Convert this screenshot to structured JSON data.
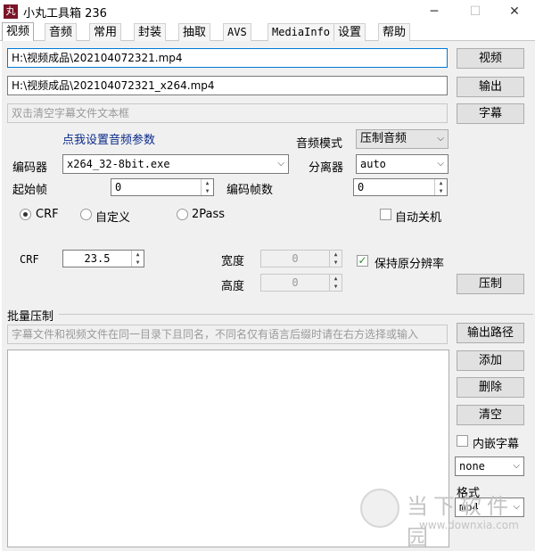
{
  "window": {
    "title": "小丸工具箱 236",
    "icon": "app-logo-icon"
  },
  "tabs": [
    "视频",
    "音频",
    "常用",
    "封装",
    "抽取",
    "AVS",
    "MediaInfo",
    "设置",
    "帮助"
  ],
  "video_file": {
    "value": "H:\\视频成品\\202104072321.mp4",
    "button": "视频"
  },
  "output_file": {
    "value": "H:\\视频成品\\202104072321_x264.mp4",
    "button": "输出"
  },
  "subtitle": {
    "placeholder": "双击清空字幕文件文本框",
    "button": "字幕"
  },
  "audio_params_link": "点我设置音频参数",
  "audio_mode": {
    "label": "音频模式",
    "value": "压制音频"
  },
  "encoder": {
    "label": "编码器",
    "value": "x264_32-8bit.exe"
  },
  "demuxer": {
    "label": "分离器",
    "value": "auto"
  },
  "start_frame": {
    "label": "起始帧",
    "value": "0"
  },
  "encode_frames": {
    "label": "编码帧数",
    "value": "0"
  },
  "modes": {
    "crf": "CRF",
    "custom": "自定义",
    "twopass": "2Pass",
    "selected": "crf"
  },
  "auto_shutdown": {
    "label": "自动关机",
    "checked": false
  },
  "crf": {
    "label": "CRF",
    "value": "23.5"
  },
  "width": {
    "label": "宽度",
    "value": "0"
  },
  "height": {
    "label": "高度",
    "value": "0"
  },
  "keep_resolution": {
    "label": "保持原分辨率",
    "checked": true
  },
  "encode_button": "压制",
  "batch": {
    "label": "批量压制",
    "placeholder": "字幕文件和视频文件在同一目录下且同名，不同名仅有语言后缀时请在右方选择或输入",
    "output_path_button": "输出路径",
    "add_button": "添加",
    "delete_button": "删除",
    "clear_button": "清空",
    "embed_subtitle": {
      "label": "内嵌字幕",
      "checked": false
    },
    "subtitle_lang": "none",
    "format_label": "格式",
    "format_value": "mp4"
  },
  "watermark": {
    "text": "当下软件园",
    "url": "www.downxia.com"
  }
}
